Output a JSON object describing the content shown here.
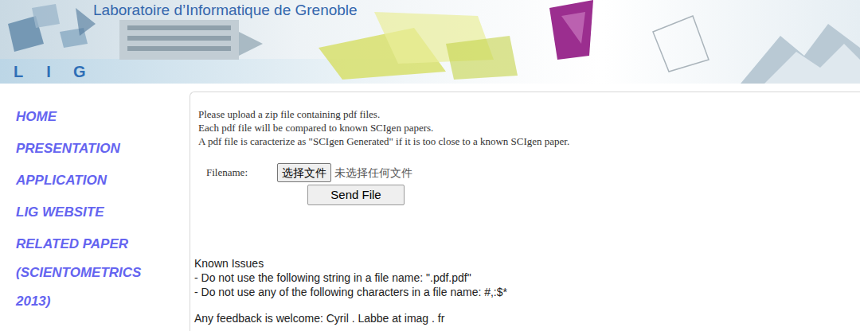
{
  "header": {
    "title": "Laboratoire d’Informatique de Grenoble",
    "logo_letters": [
      "L",
      "I",
      "G"
    ]
  },
  "nav": [
    {
      "lines": [
        "HOME"
      ]
    },
    {
      "lines": [
        "PRESENTATION"
      ]
    },
    {
      "lines": [
        "APPLICATION"
      ]
    },
    {
      "lines": [
        "LIG WEBSITE"
      ]
    },
    {
      "lines": [
        "RELATED PAPER",
        "(SCIENTOMETRICS",
        "2013)"
      ]
    }
  ],
  "upload": {
    "instructions": [
      "Please upload a zip file containing pdf files.",
      "Each pdf file will be compared to known SCIgen papers.",
      "A pdf file is caracterize as \"SCIgen Generated\" if it is too close to a known SCIgen paper."
    ],
    "field_label": "Filename:",
    "choose_button": "选择文件",
    "file_status": "未选择任何文件",
    "submit_button": "Send File"
  },
  "known_issues": {
    "title": "Known Issues",
    "items": [
      "- Do not use the following string in a file name: \".pdf.pdf\"",
      "- Do not use any of the following characters in a file name: #,:$*"
    ]
  },
  "feedback": "Any feedback is welcome: Cyril . Labbe at imag . fr"
}
